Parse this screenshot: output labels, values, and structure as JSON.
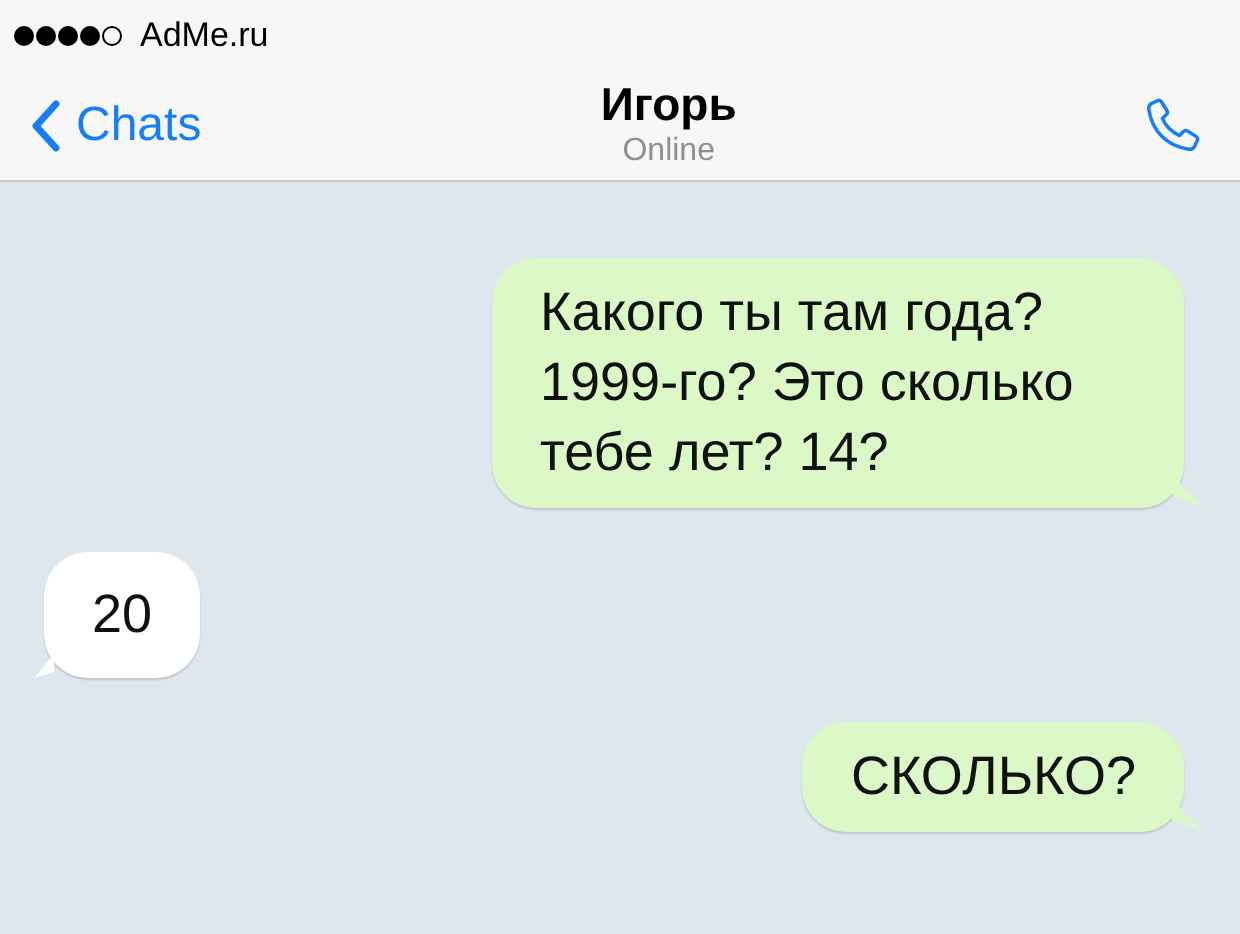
{
  "status_bar": {
    "carrier": "AdMe.ru"
  },
  "nav_bar": {
    "back_label": "Chats",
    "title": "Игорь",
    "subtitle": "Online"
  },
  "messages": [
    {
      "kind": "outgoing",
      "text": "Какого ты там года? 1999-го? Это сколько тебе лет? 14?"
    },
    {
      "kind": "incoming",
      "text": "20"
    },
    {
      "kind": "outgoing",
      "text": "СКОЛЬКО?"
    }
  ]
}
